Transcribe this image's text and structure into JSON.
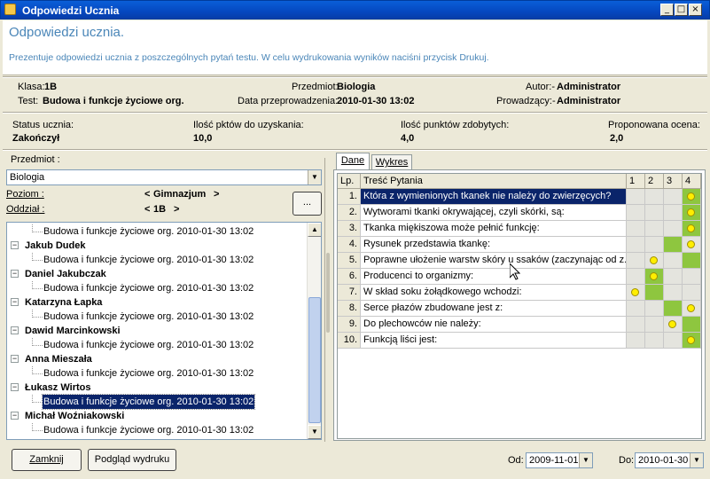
{
  "window": {
    "title": "Odpowiedzi Ucznia"
  },
  "header": {
    "title": "Odpowiedzi ucznia.",
    "description": "Prezentuje odpowiedzi ucznia z poszczególnych pytań testu. W celu wydrukowania wyników naciśni przycisk Drukuj."
  },
  "info": {
    "klasa_label": "Klasa:",
    "klasa_value": "1B",
    "test_label": "Test:",
    "test_value": "Budowa i funkcje życiowe org.",
    "przedmiot_label": "Przedmiot:",
    "przedmiot_value": "Biologia",
    "data_label": "Data przeprowadzenia:",
    "data_value": "2010-01-30 13:02",
    "autor_label": "Autor:-",
    "autor_value": "Administrator",
    "prowadzacy_label": "Prowadzący:-",
    "prowadzacy_value": "Administrator"
  },
  "status": {
    "status_label": "Status ucznia:",
    "status_value": "Zakończył",
    "pkt_max_label": "Ilość pktów do uzyskania:",
    "pkt_max_value": "10,0",
    "pkt_label": "Ilość punktów zdobytych:",
    "pkt_value": "4,0",
    "ocena_label": "Proponowana ocena:",
    "ocena_value": "2,0"
  },
  "filters": {
    "przedmiot_label": "Przedmiot :",
    "przedmiot_value": "Biologia",
    "poziom_label": "Poziom :",
    "poziom_value": "Gimnazjum",
    "oddzial_label": "Oddział :",
    "oddzial_value": "1B",
    "prev_arrow": "<",
    "next_arrow": ">",
    "more_button": "..."
  },
  "tree": {
    "items": [
      {
        "type": "test",
        "text": "Budowa i funkcje życiowe org. 2010-01-30 13:02",
        "selected": false
      },
      {
        "type": "student",
        "text": "Jakub Dudek"
      },
      {
        "type": "test",
        "text": "Budowa i funkcje życiowe org. 2010-01-30 13:02",
        "selected": false
      },
      {
        "type": "student",
        "text": "Daniel Jakubczak"
      },
      {
        "type": "test",
        "text": "Budowa i funkcje życiowe org. 2010-01-30 13:02",
        "selected": false
      },
      {
        "type": "student",
        "text": "Katarzyna Łapka"
      },
      {
        "type": "test",
        "text": "Budowa i funkcje życiowe org. 2010-01-30 13:02",
        "selected": false
      },
      {
        "type": "student",
        "text": "Dawid Marcinkowski"
      },
      {
        "type": "test",
        "text": "Budowa i funkcje życiowe org. 2010-01-30 13:02",
        "selected": false
      },
      {
        "type": "student",
        "text": "Anna Mieszała"
      },
      {
        "type": "test",
        "text": "Budowa i funkcje życiowe org. 2010-01-30 13:02",
        "selected": false
      },
      {
        "type": "student",
        "text": "Łukasz Wirtos"
      },
      {
        "type": "test",
        "text": "Budowa i funkcje życiowe org. 2010-01-30 13:02",
        "selected": true
      },
      {
        "type": "student",
        "text": "Michał Woźniakowski"
      },
      {
        "type": "test",
        "text": "Budowa i funkcje życiowe org. 2010-01-30 13:02",
        "selected": false
      }
    ]
  },
  "tabs": [
    {
      "label": "Dane",
      "active": true
    },
    {
      "label": "Wykres",
      "active": false
    }
  ],
  "grid": {
    "columns": [
      "Lp.",
      "Treść Pytania",
      "1",
      "2",
      "3",
      "4"
    ],
    "rows": [
      {
        "lp": "1.",
        "text": "Która z wymienionych tkanek nie należy do zwierzęcych?",
        "correct": 4,
        "answer": 4,
        "selected": true
      },
      {
        "lp": "2.",
        "text": "Wytworami tkanki okrywającej, czyli skórki, są:",
        "correct": 4,
        "answer": 4
      },
      {
        "lp": "3.",
        "text": "Tkanka miękiszowa może pełnić funkcję:",
        "correct": 4,
        "answer": 4
      },
      {
        "lp": "4.",
        "text": "Rysunek przedstawia tkankę:",
        "correct": 3,
        "answer": 4
      },
      {
        "lp": "5.",
        "text": "Poprawne ułożenie warstw skóry u ssaków (zaczynając od z...",
        "correct": 4,
        "answer": 2
      },
      {
        "lp": "6.",
        "text": "Producenci to organizmy:",
        "correct": 2,
        "answer": 2
      },
      {
        "lp": "7.",
        "text": "W skład soku żołądkowego wchodzi:",
        "correct": 2,
        "answer": 1
      },
      {
        "lp": "8.",
        "text": "Serce płazów zbudowane jest z:",
        "correct": 3,
        "answer": 4
      },
      {
        "lp": "9.",
        "text": "Do plechowców nie należy:",
        "correct": 4,
        "answer": 3
      },
      {
        "lp": "10.",
        "text": "Funkcją liści jest:",
        "correct": 4,
        "answer": 4
      }
    ]
  },
  "footer": {
    "close_label": "Zamknij",
    "preview_label": "Podgląd wydruku",
    "od_label": "Od:",
    "od_value": "2009-11-01",
    "do_label": "Do:",
    "do_value": "2010-01-30"
  },
  "colors": {
    "correct_green": "#8ec63f",
    "selected_blue": "#0a246a",
    "answer_dot": "#ffee00"
  }
}
